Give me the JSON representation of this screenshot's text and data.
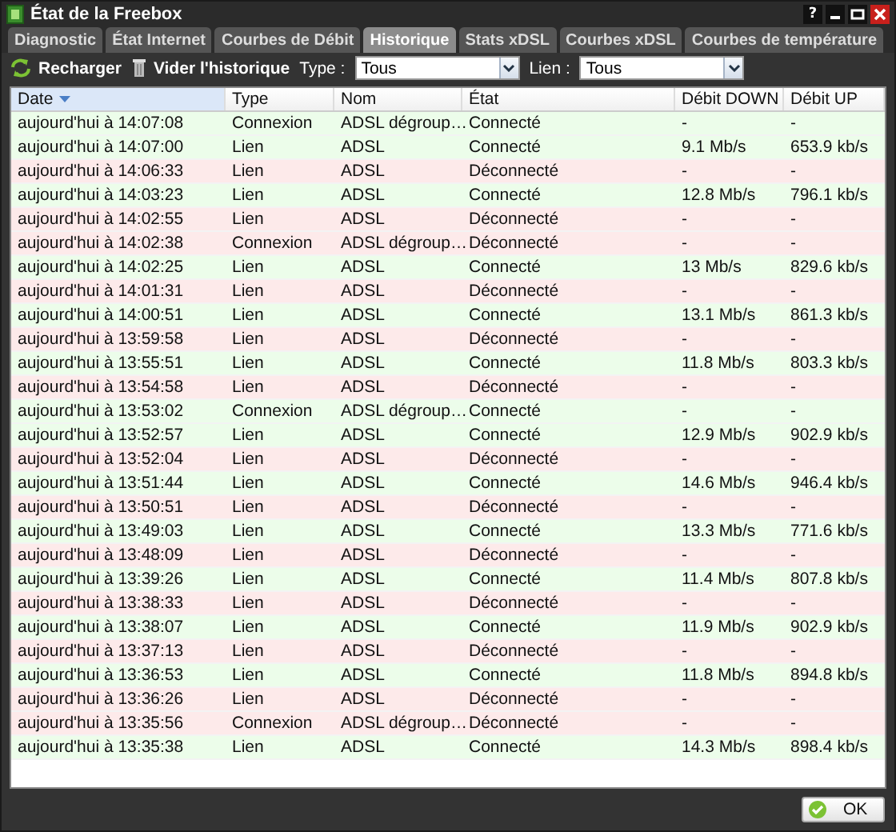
{
  "window": {
    "title": "État de la Freebox",
    "controls": [
      "?"
    ]
  },
  "tabs": [
    {
      "label": "Diagnostic",
      "selected": false
    },
    {
      "label": "État Internet",
      "selected": false
    },
    {
      "label": "Courbes de Débit",
      "selected": false
    },
    {
      "label": "Historique",
      "selected": true
    },
    {
      "label": "Stats xDSL",
      "selected": false
    },
    {
      "label": "Courbes xDSL",
      "selected": false
    },
    {
      "label": "Courbes de température",
      "selected": false
    }
  ],
  "toolbar": {
    "buttons": [
      {
        "kind": "reload",
        "label": "Recharger"
      },
      {
        "kind": "clear",
        "label": "Vider l'historique"
      }
    ],
    "filters": [
      {
        "label": "Type :",
        "value": "Tous"
      },
      {
        "label": "Lien :",
        "value": "Tous"
      }
    ]
  },
  "table": {
    "columns": [
      {
        "label": "Date",
        "sorted": true
      },
      {
        "label": "Type",
        "sorted": false
      },
      {
        "label": "Nom",
        "sorted": false
      },
      {
        "label": "État",
        "sorted": false
      },
      {
        "label": "Débit DOWN",
        "sorted": false
      },
      {
        "label": "Débit UP",
        "sorted": false
      }
    ],
    "rows": [
      {
        "connected": true,
        "cells": [
          "aujourd'hui à 14:07:08",
          "Connexion",
          "ADSL dégroup…",
          "Connecté",
          "-",
          "-"
        ]
      },
      {
        "connected": true,
        "cells": [
          "aujourd'hui à 14:07:00",
          "Lien",
          "ADSL",
          "Connecté",
          "9.1 Mb/s",
          "653.9 kb/s"
        ]
      },
      {
        "connected": false,
        "cells": [
          "aujourd'hui à 14:06:33",
          "Lien",
          "ADSL",
          "Déconnecté",
          "-",
          "-"
        ]
      },
      {
        "connected": true,
        "cells": [
          "aujourd'hui à 14:03:23",
          "Lien",
          "ADSL",
          "Connecté",
          "12.8 Mb/s",
          "796.1 kb/s"
        ]
      },
      {
        "connected": false,
        "cells": [
          "aujourd'hui à 14:02:55",
          "Lien",
          "ADSL",
          "Déconnecté",
          "-",
          "-"
        ]
      },
      {
        "connected": false,
        "cells": [
          "aujourd'hui à 14:02:38",
          "Connexion",
          "ADSL dégroup…",
          "Déconnecté",
          "-",
          "-"
        ]
      },
      {
        "connected": true,
        "cells": [
          "aujourd'hui à 14:02:25",
          "Lien",
          "ADSL",
          "Connecté",
          "13 Mb/s",
          "829.6 kb/s"
        ]
      },
      {
        "connected": false,
        "cells": [
          "aujourd'hui à 14:01:31",
          "Lien",
          "ADSL",
          "Déconnecté",
          "-",
          "-"
        ]
      },
      {
        "connected": true,
        "cells": [
          "aujourd'hui à 14:00:51",
          "Lien",
          "ADSL",
          "Connecté",
          "13.1 Mb/s",
          "861.3 kb/s"
        ]
      },
      {
        "connected": false,
        "cells": [
          "aujourd'hui à 13:59:58",
          "Lien",
          "ADSL",
          "Déconnecté",
          "-",
          "-"
        ]
      },
      {
        "connected": true,
        "cells": [
          "aujourd'hui à 13:55:51",
          "Lien",
          "ADSL",
          "Connecté",
          "11.8 Mb/s",
          "803.3 kb/s"
        ]
      },
      {
        "connected": false,
        "cells": [
          "aujourd'hui à 13:54:58",
          "Lien",
          "ADSL",
          "Déconnecté",
          "-",
          "-"
        ]
      },
      {
        "connected": true,
        "cells": [
          "aujourd'hui à 13:53:02",
          "Connexion",
          "ADSL dégroup…",
          "Connecté",
          "-",
          "-"
        ]
      },
      {
        "connected": true,
        "cells": [
          "aujourd'hui à 13:52:57",
          "Lien",
          "ADSL",
          "Connecté",
          "12.9 Mb/s",
          "902.9 kb/s"
        ]
      },
      {
        "connected": false,
        "cells": [
          "aujourd'hui à 13:52:04",
          "Lien",
          "ADSL",
          "Déconnecté",
          "-",
          "-"
        ]
      },
      {
        "connected": true,
        "cells": [
          "aujourd'hui à 13:51:44",
          "Lien",
          "ADSL",
          "Connecté",
          "14.6 Mb/s",
          "946.4 kb/s"
        ]
      },
      {
        "connected": false,
        "cells": [
          "aujourd'hui à 13:50:51",
          "Lien",
          "ADSL",
          "Déconnecté",
          "-",
          "-"
        ]
      },
      {
        "connected": true,
        "cells": [
          "aujourd'hui à 13:49:03",
          "Lien",
          "ADSL",
          "Connecté",
          "13.3 Mb/s",
          "771.6 kb/s"
        ]
      },
      {
        "connected": false,
        "cells": [
          "aujourd'hui à 13:48:09",
          "Lien",
          "ADSL",
          "Déconnecté",
          "-",
          "-"
        ]
      },
      {
        "connected": true,
        "cells": [
          "aujourd'hui à 13:39:26",
          "Lien",
          "ADSL",
          "Connecté",
          "11.4 Mb/s",
          "807.8 kb/s"
        ]
      },
      {
        "connected": false,
        "cells": [
          "aujourd'hui à 13:38:33",
          "Lien",
          "ADSL",
          "Déconnecté",
          "-",
          "-"
        ]
      },
      {
        "connected": true,
        "cells": [
          "aujourd'hui à 13:38:07",
          "Lien",
          "ADSL",
          "Connecté",
          "11.9 Mb/s",
          "902.9 kb/s"
        ]
      },
      {
        "connected": false,
        "cells": [
          "aujourd'hui à 13:37:13",
          "Lien",
          "ADSL",
          "Déconnecté",
          "-",
          "-"
        ]
      },
      {
        "connected": true,
        "cells": [
          "aujourd'hui à 13:36:53",
          "Lien",
          "ADSL",
          "Connecté",
          "11.8 Mb/s",
          "894.8 kb/s"
        ]
      },
      {
        "connected": false,
        "cells": [
          "aujourd'hui à 13:36:26",
          "Lien",
          "ADSL",
          "Déconnecté",
          "-",
          "-"
        ]
      },
      {
        "connected": false,
        "cells": [
          "aujourd'hui à 13:35:56",
          "Connexion",
          "ADSL dégroup…",
          "Déconnecté",
          "-",
          "-"
        ]
      },
      {
        "connected": true,
        "cells": [
          "aujourd'hui à 13:35:38",
          "Lien",
          "ADSL",
          "Connecté",
          "14.3 Mb/s",
          "898.4 kb/s"
        ]
      }
    ]
  },
  "footer": {
    "button": "OK"
  }
}
